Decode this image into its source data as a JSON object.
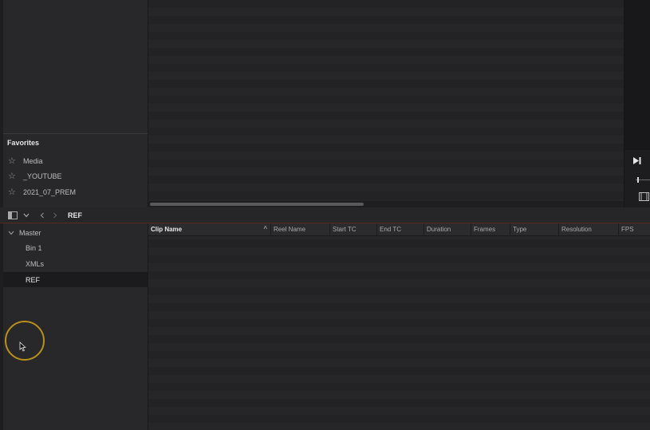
{
  "favorites": {
    "title": "Favorites",
    "items": [
      {
        "label": "Media",
        "icon": "star-icon"
      },
      {
        "label": "_YOUTUBE",
        "icon": "star-icon"
      },
      {
        "label": "2021_07_PREM",
        "icon": "star-icon"
      }
    ]
  },
  "toolbar": {
    "bin_title": "REF",
    "icons": [
      "sidebar-toggle-icon",
      "chevron-down-icon",
      "chevron-left-icon",
      "chevron-right-icon"
    ]
  },
  "tree": {
    "root": "Master",
    "items": [
      {
        "label": "Bin 1",
        "selected": false
      },
      {
        "label": "XMLs",
        "selected": false
      },
      {
        "label": "REF",
        "selected": true
      }
    ]
  },
  "table": {
    "columns": [
      "Clip Name",
      "Reel Name",
      "Start TC",
      "End TC",
      "Duration",
      "Frames",
      "Type",
      "Resolution",
      "FPS"
    ],
    "sort_indicator": "^",
    "rows": []
  },
  "colors": {
    "accent_line": "#5a2b24",
    "cursor_ring": "#b8901c"
  }
}
